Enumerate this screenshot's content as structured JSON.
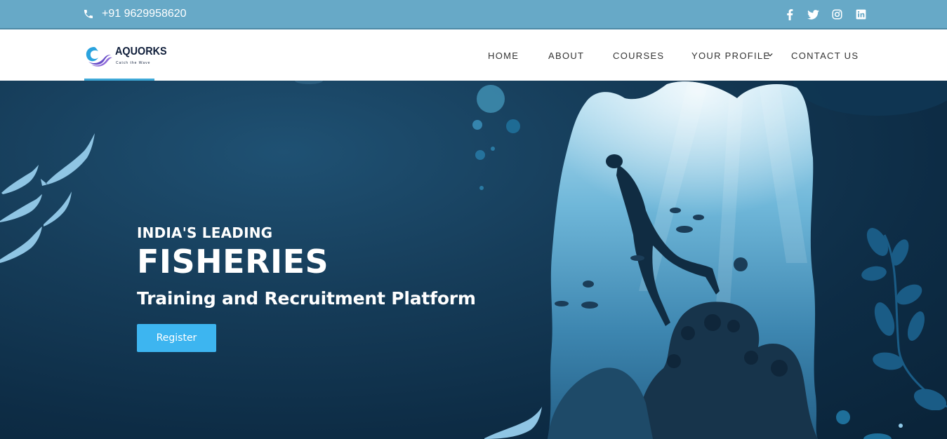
{
  "topbar": {
    "phone": "+91 9629958620",
    "phone_icon": "phone-icon",
    "social_icons": [
      "facebook-icon",
      "twitter-icon",
      "instagram-icon",
      "linkedin-icon"
    ]
  },
  "brand": {
    "name": "AQUORKS",
    "tagline": "Catch the Wave"
  },
  "nav": {
    "items": [
      {
        "label": "HOME"
      },
      {
        "label": "ABOUT"
      },
      {
        "label": "COURSES"
      },
      {
        "label": "YOUR PROFILE",
        "dropdown": true
      },
      {
        "label": "CONTACT US"
      }
    ]
  },
  "hero": {
    "eyebrow": "INDIA'S LEADING",
    "headline": "FISHERIES",
    "subline": "Training and Recruitment Platform",
    "cta": "Register"
  },
  "colors": {
    "topbar": "#67a9c7",
    "accent": "#3db5f0",
    "hero_dark": "#0d2c45"
  }
}
